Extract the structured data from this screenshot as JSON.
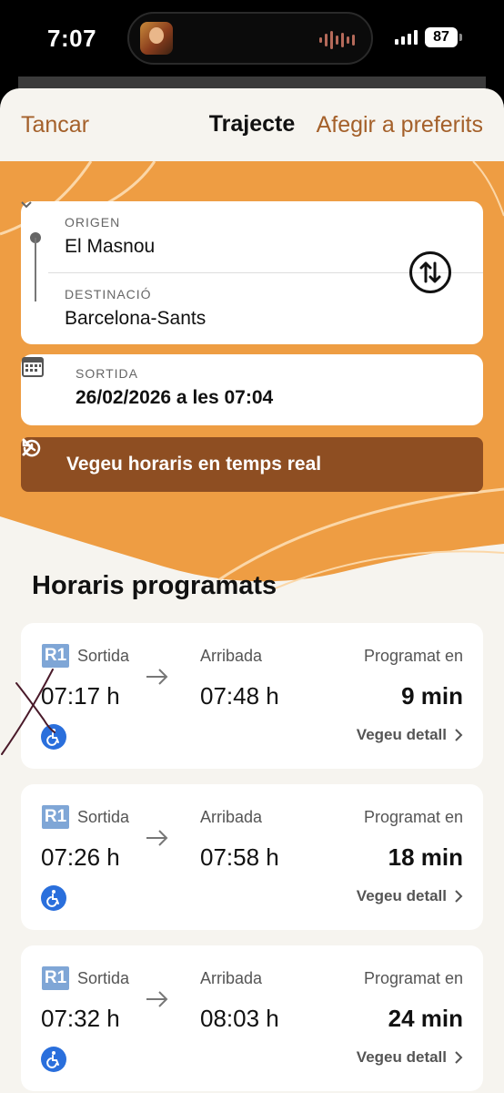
{
  "status": {
    "time": "7:07",
    "battery": "87"
  },
  "nav": {
    "close": "Tancar",
    "title": "Trajecte",
    "favorite": "Afegir a preferits"
  },
  "route": {
    "origin_label": "ORIGEN",
    "origin": "El Masnou",
    "destination_label": "DESTINACIÓ",
    "destination": "Barcelona-Sants"
  },
  "departure": {
    "label": "SORTIDA",
    "value": "26/02/2026 a les 07:04"
  },
  "realtime_button": "Vegeu horaris en temps real",
  "section_title": "Horaris programats",
  "trips": [
    {
      "line": "R1",
      "dep_label": "Sortida",
      "dep": "07:17 h",
      "arr_label": "Arribada",
      "arr": "07:48 h",
      "in_label": "Programat en",
      "in": "9 min",
      "detail": "Vegeu detall"
    },
    {
      "line": "R1",
      "dep_label": "Sortida",
      "dep": "07:26 h",
      "arr_label": "Arribada",
      "arr": "07:58 h",
      "in_label": "Programat en",
      "in": "18 min",
      "detail": "Vegeu detall"
    },
    {
      "line": "R1",
      "dep_label": "Sortida",
      "dep": "07:32 h",
      "arr_label": "Arribada",
      "arr": "08:03 h",
      "in_label": "Programat en",
      "in": "24 min",
      "detail": "Vegeu detall"
    }
  ],
  "colors": {
    "accent": "#a4602a",
    "orange": "#ee9d43",
    "button": "#8e4e22",
    "r1": "#7fa6d6",
    "access": "#2a6fdc"
  },
  "icons": [
    "swap-icon",
    "calendar-icon",
    "history-icon",
    "chevron-right-icon",
    "arrow-right-icon",
    "accessibility-icon"
  ]
}
